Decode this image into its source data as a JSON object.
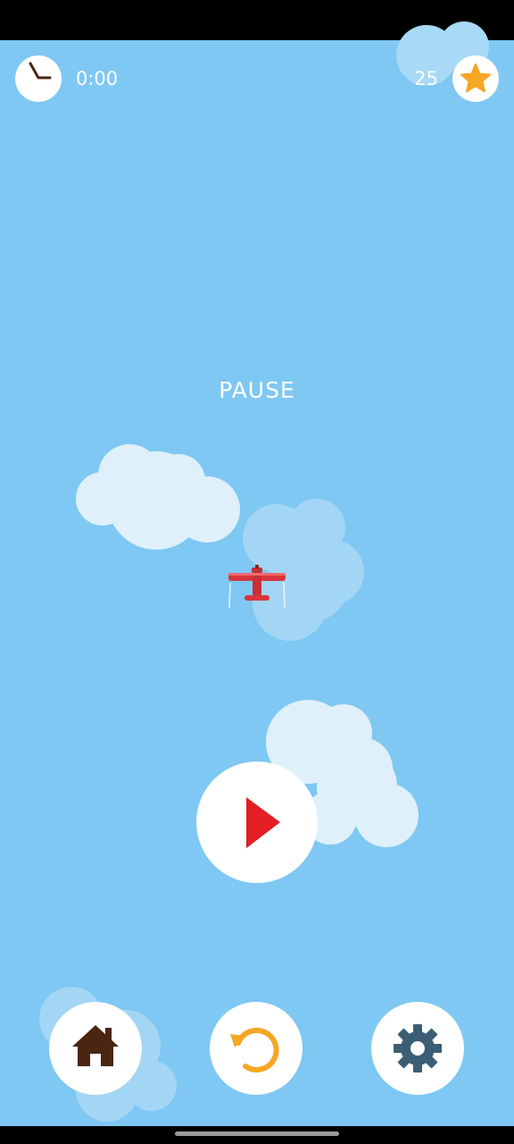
{
  "hud": {
    "timer": "0:00",
    "score": "25",
    "timer_icon": "clock-icon",
    "score_icon": "star-icon"
  },
  "pause": {
    "title": "PAUSE"
  },
  "buttons": {
    "play_icon": "play-icon",
    "home_icon": "home-icon",
    "restart_icon": "restart-icon",
    "settings_icon": "gear-icon"
  },
  "colors": {
    "sky": "#7ec8f3",
    "play_triangle": "#e31e24",
    "home_icon": "#4a2511",
    "restart_icon": "#f5a623",
    "gear_icon": "#3b5e75",
    "star": "#f5a623",
    "plane": "#d9363e"
  }
}
